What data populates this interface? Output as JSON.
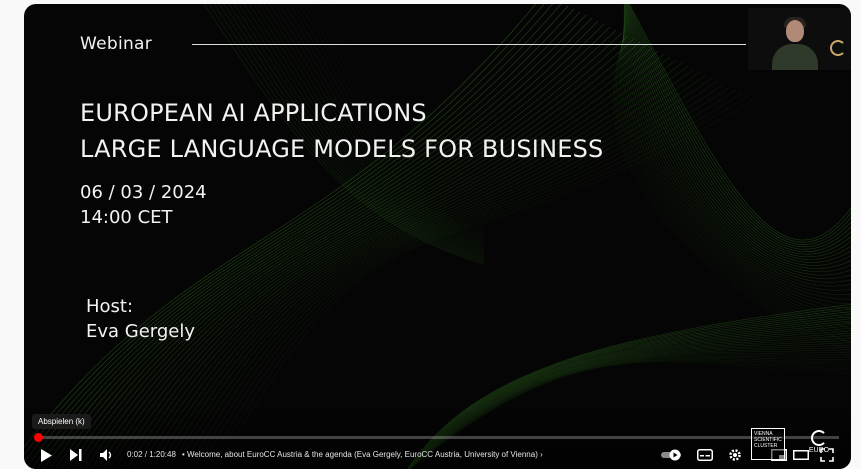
{
  "slide": {
    "label": "Webinar",
    "title_line1": "EUROPEAN AI APPLICATIONS",
    "title_line2": "LARGE LANGUAGE MODELS FOR BUSINESS",
    "date": "06 / 03 / 2024",
    "time": "14:00 CET",
    "host_label": "Host:",
    "host_name": "Eva Gergely"
  },
  "player": {
    "tooltip": "Abspielen (k)",
    "current_time": "0:02 / 1:20:48",
    "chapter": "• Welcome, about EuroCC Austria & the agenda (Eva Gergely, EuroCC Austria, University of Vienna)",
    "chapter_chevron": "›",
    "progress_fraction": 0.0008,
    "accent_color": "#ff0000",
    "icons": [
      "play-icon",
      "next-icon",
      "volume-icon",
      "autoplay-toggle-icon",
      "subtitles-icon",
      "settings-icon",
      "miniplayer-icon",
      "theater-icon",
      "fullscreen-icon"
    ]
  },
  "watermarks": {
    "vsc_text": "VIENNA SCIENTIFIC CLUSTER",
    "euro_text": "EURO"
  },
  "colors": {
    "background": "#050505",
    "accent_green": "#3f8f2a"
  }
}
